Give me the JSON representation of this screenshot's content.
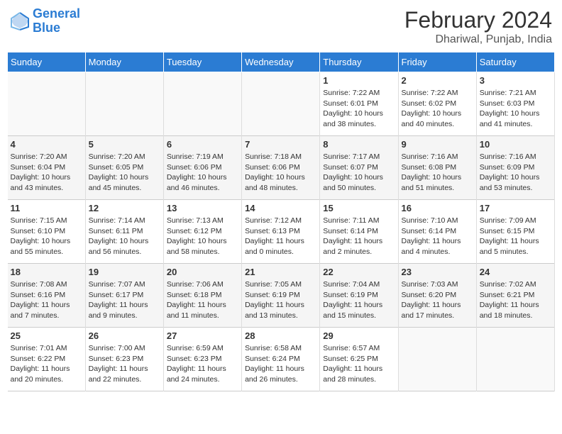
{
  "header": {
    "logo_line1": "General",
    "logo_line2": "Blue",
    "month": "February 2024",
    "location": "Dhariwal, Punjab, India"
  },
  "weekdays": [
    "Sunday",
    "Monday",
    "Tuesday",
    "Wednesday",
    "Thursday",
    "Friday",
    "Saturday"
  ],
  "weeks": [
    [
      {
        "day": "",
        "info": ""
      },
      {
        "day": "",
        "info": ""
      },
      {
        "day": "",
        "info": ""
      },
      {
        "day": "",
        "info": ""
      },
      {
        "day": "1",
        "info": "Sunrise: 7:22 AM\nSunset: 6:01 PM\nDaylight: 10 hours\nand 38 minutes."
      },
      {
        "day": "2",
        "info": "Sunrise: 7:22 AM\nSunset: 6:02 PM\nDaylight: 10 hours\nand 40 minutes."
      },
      {
        "day": "3",
        "info": "Sunrise: 7:21 AM\nSunset: 6:03 PM\nDaylight: 10 hours\nand 41 minutes."
      }
    ],
    [
      {
        "day": "4",
        "info": "Sunrise: 7:20 AM\nSunset: 6:04 PM\nDaylight: 10 hours\nand 43 minutes."
      },
      {
        "day": "5",
        "info": "Sunrise: 7:20 AM\nSunset: 6:05 PM\nDaylight: 10 hours\nand 45 minutes."
      },
      {
        "day": "6",
        "info": "Sunrise: 7:19 AM\nSunset: 6:06 PM\nDaylight: 10 hours\nand 46 minutes."
      },
      {
        "day": "7",
        "info": "Sunrise: 7:18 AM\nSunset: 6:06 PM\nDaylight: 10 hours\nand 48 minutes."
      },
      {
        "day": "8",
        "info": "Sunrise: 7:17 AM\nSunset: 6:07 PM\nDaylight: 10 hours\nand 50 minutes."
      },
      {
        "day": "9",
        "info": "Sunrise: 7:16 AM\nSunset: 6:08 PM\nDaylight: 10 hours\nand 51 minutes."
      },
      {
        "day": "10",
        "info": "Sunrise: 7:16 AM\nSunset: 6:09 PM\nDaylight: 10 hours\nand 53 minutes."
      }
    ],
    [
      {
        "day": "11",
        "info": "Sunrise: 7:15 AM\nSunset: 6:10 PM\nDaylight: 10 hours\nand 55 minutes."
      },
      {
        "day": "12",
        "info": "Sunrise: 7:14 AM\nSunset: 6:11 PM\nDaylight: 10 hours\nand 56 minutes."
      },
      {
        "day": "13",
        "info": "Sunrise: 7:13 AM\nSunset: 6:12 PM\nDaylight: 10 hours\nand 58 minutes."
      },
      {
        "day": "14",
        "info": "Sunrise: 7:12 AM\nSunset: 6:13 PM\nDaylight: 11 hours\nand 0 minutes."
      },
      {
        "day": "15",
        "info": "Sunrise: 7:11 AM\nSunset: 6:14 PM\nDaylight: 11 hours\nand 2 minutes."
      },
      {
        "day": "16",
        "info": "Sunrise: 7:10 AM\nSunset: 6:14 PM\nDaylight: 11 hours\nand 4 minutes."
      },
      {
        "day": "17",
        "info": "Sunrise: 7:09 AM\nSunset: 6:15 PM\nDaylight: 11 hours\nand 5 minutes."
      }
    ],
    [
      {
        "day": "18",
        "info": "Sunrise: 7:08 AM\nSunset: 6:16 PM\nDaylight: 11 hours\nand 7 minutes."
      },
      {
        "day": "19",
        "info": "Sunrise: 7:07 AM\nSunset: 6:17 PM\nDaylight: 11 hours\nand 9 minutes."
      },
      {
        "day": "20",
        "info": "Sunrise: 7:06 AM\nSunset: 6:18 PM\nDaylight: 11 hours\nand 11 minutes."
      },
      {
        "day": "21",
        "info": "Sunrise: 7:05 AM\nSunset: 6:19 PM\nDaylight: 11 hours\nand 13 minutes."
      },
      {
        "day": "22",
        "info": "Sunrise: 7:04 AM\nSunset: 6:19 PM\nDaylight: 11 hours\nand 15 minutes."
      },
      {
        "day": "23",
        "info": "Sunrise: 7:03 AM\nSunset: 6:20 PM\nDaylight: 11 hours\nand 17 minutes."
      },
      {
        "day": "24",
        "info": "Sunrise: 7:02 AM\nSunset: 6:21 PM\nDaylight: 11 hours\nand 18 minutes."
      }
    ],
    [
      {
        "day": "25",
        "info": "Sunrise: 7:01 AM\nSunset: 6:22 PM\nDaylight: 11 hours\nand 20 minutes."
      },
      {
        "day": "26",
        "info": "Sunrise: 7:00 AM\nSunset: 6:23 PM\nDaylight: 11 hours\nand 22 minutes."
      },
      {
        "day": "27",
        "info": "Sunrise: 6:59 AM\nSunset: 6:23 PM\nDaylight: 11 hours\nand 24 minutes."
      },
      {
        "day": "28",
        "info": "Sunrise: 6:58 AM\nSunset: 6:24 PM\nDaylight: 11 hours\nand 26 minutes."
      },
      {
        "day": "29",
        "info": "Sunrise: 6:57 AM\nSunset: 6:25 PM\nDaylight: 11 hours\nand 28 minutes."
      },
      {
        "day": "",
        "info": ""
      },
      {
        "day": "",
        "info": ""
      }
    ]
  ]
}
